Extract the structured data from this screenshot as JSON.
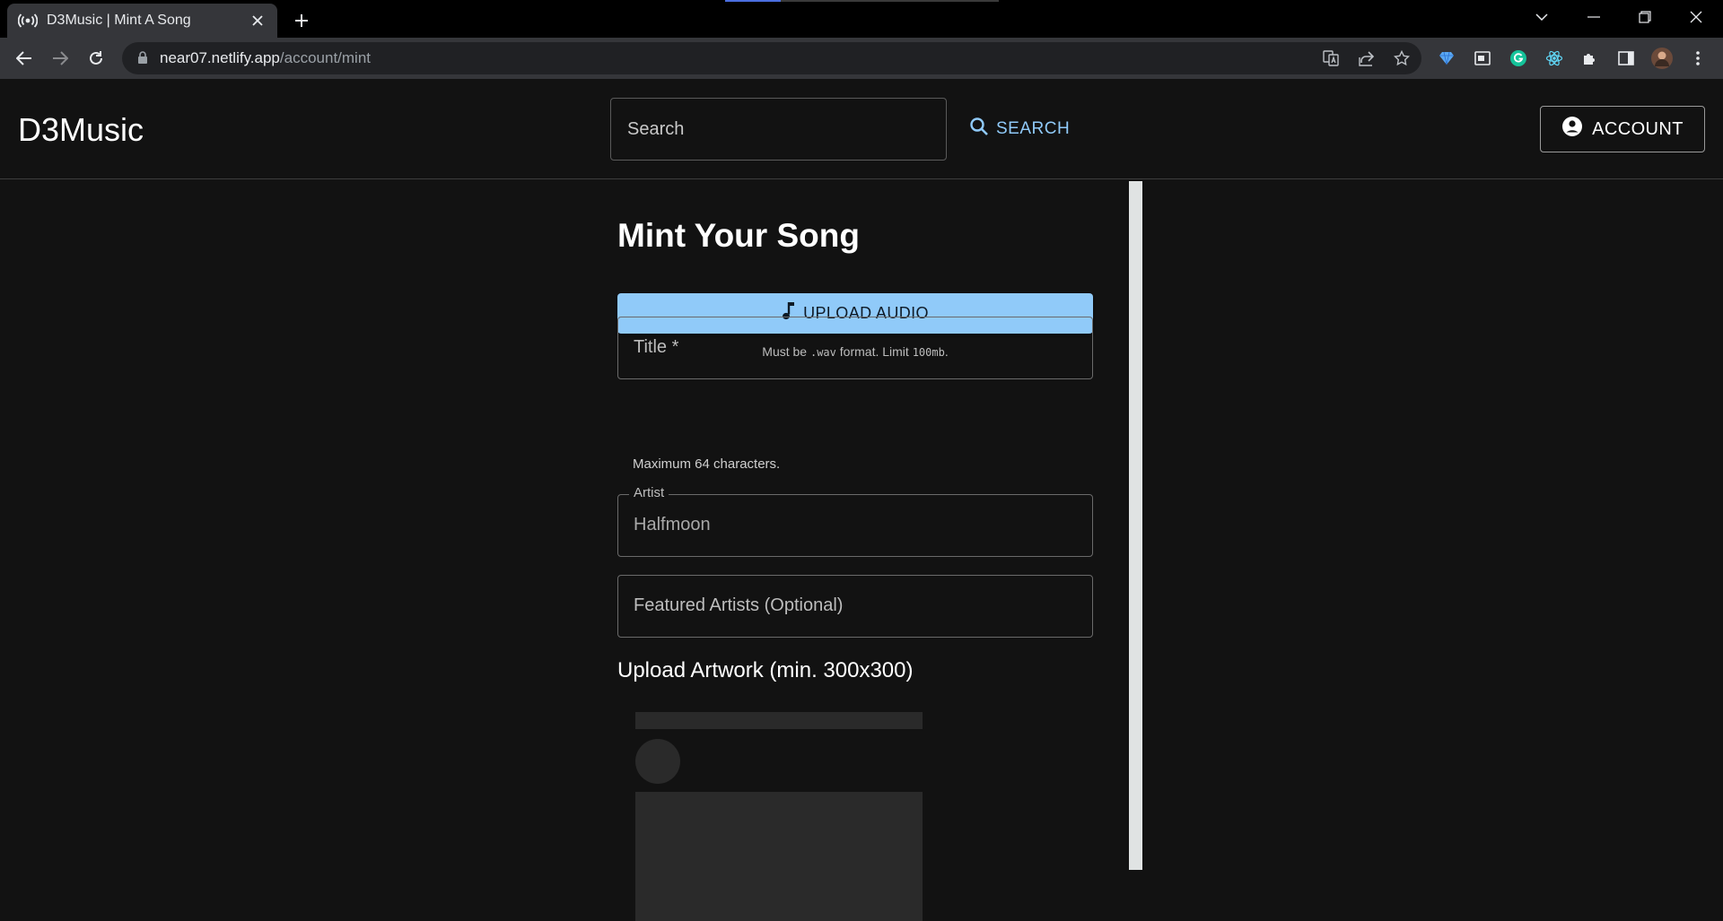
{
  "browser": {
    "tab_title": "D3Music | Mint A Song",
    "url_host": "near07.netlify.app",
    "url_path": "/account/mint"
  },
  "app": {
    "brand": "D3Music",
    "search_placeholder": "Search",
    "search_button": "SEARCH",
    "account_button": "ACCOUNT"
  },
  "form": {
    "title": "Mint Your Song",
    "upload_audio_label": "UPLOAD AUDIO",
    "upload_hint_prefix": "Must be ",
    "upload_hint_format": ".wav",
    "upload_hint_middle": " format. Limit ",
    "upload_hint_limit": "100mb",
    "upload_hint_suffix": ".",
    "title_field_label": "Title *",
    "title_helper": "Maximum 64 characters.",
    "artist_label": "Artist",
    "artist_value": "Halfmoon",
    "featured_label": "Featured Artists (Optional)",
    "artwork_heading": "Upload Artwork (min. 300x300)"
  }
}
